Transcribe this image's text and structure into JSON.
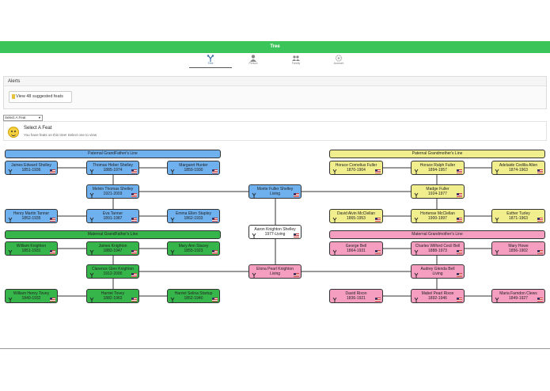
{
  "app": {
    "title": "Tree"
  },
  "nav": [
    {
      "label": "Tree",
      "icon": "tree-icon"
    },
    {
      "label": "Person",
      "icon": "person-icon"
    },
    {
      "label": "Family",
      "icon": "family-icon"
    },
    {
      "label": "Account",
      "icon": "gear-icon"
    }
  ],
  "alerts": {
    "title": "Alerts",
    "feats_label": "View 48 suggested feats"
  },
  "select_feat": {
    "value": "Select A Feat"
  },
  "feat_panel": {
    "title": "Select A Feat",
    "subtitle": "You have feats on this tree! Select one to view"
  },
  "lines": {
    "paternal_grandfather": "Paternal GrandFather's Line",
    "paternal_grandmother": "Paternal Grandmother's Line",
    "maternal_grandfather": "Maternal GrandFather's Line",
    "maternal_grandmother": "Maternal Grandmother's Line"
  },
  "people": {
    "pgf_1": {
      "name": "James Edward Shelley",
      "dates": "1851-1936"
    },
    "pgf_2": {
      "name": "Thomas Heber Shelley",
      "dates": "1885-1974"
    },
    "pgf_3": {
      "name": "Margaret Hunter",
      "dates": "1859-1930"
    },
    "pgf_4": {
      "name": "Melvin Thomas Shelley",
      "dates": "1921-2003"
    },
    "pgf_5": {
      "name": "Henry Martin Tanner",
      "dates": "1852-1935"
    },
    "pgf_6": {
      "name": "Eva Tanner",
      "dates": "1891-1987"
    },
    "pgf_7": {
      "name": "Emma Ellen Stapley",
      "dates": "1862-1933"
    },
    "father": {
      "name": "Monte Fuller Shelley",
      "dates": "Living"
    },
    "self": {
      "name": "Aaron Knighton Shelley",
      "dates": "1977-Living"
    },
    "mother": {
      "name": "Elona Pearl Knighton",
      "dates": "Living"
    },
    "pgm_1": {
      "name": "Horace Cornelius Fuller",
      "dates": "1870-1904"
    },
    "pgm_2": {
      "name": "Horace Ralph Fuller",
      "dates": "1894-1957"
    },
    "pgm_3": {
      "name": "Adelaide Cedilia Allen",
      "dates": "1874-1963"
    },
    "pgm_4": {
      "name": "Madge Fuller",
      "dates": "1924-1977"
    },
    "pgm_5": {
      "name": "David Alvin McClellan",
      "dates": "1865-1953"
    },
    "pgm_6": {
      "name": "Hortense McClellan",
      "dates": "1900-1997"
    },
    "pgm_7": {
      "name": "Esther Turley",
      "dates": "1871-1963"
    },
    "mgf_1": {
      "name": "William Knighton",
      "dates": "1851-1931"
    },
    "mgf_2": {
      "name": "James Knighton",
      "dates": "1882-1947"
    },
    "mgf_3": {
      "name": "Mary Ann Stacey",
      "dates": "1855-1923"
    },
    "mgf_4": {
      "name": "Clarence Glen Knighton",
      "dates": "1912-2000"
    },
    "mgf_5": {
      "name": "William Henry Tovey",
      "dates": "1840-1932"
    },
    "mgf_6": {
      "name": "Harriet Tovey",
      "dates": "1882-1963"
    },
    "mgf_7": {
      "name": "Harriet Selina Startup",
      "dates": "1852-1940"
    },
    "mgm_1": {
      "name": "George Bell",
      "dates": "1864-1931"
    },
    "mgm_2": {
      "name": "Charles Wilford Cecil Bell",
      "dates": "1888-1973"
    },
    "mgm_3": {
      "name": "Mary Howe",
      "dates": "1856-1902"
    },
    "mgm_4": {
      "name": "Audrey Glenda Bell",
      "dates": "Living"
    },
    "mgm_5": {
      "name": "David Rixon",
      "dates": "1836-1921"
    },
    "mgm_6": {
      "name": "Mabel Pearl Rixon",
      "dates": "1892-1946"
    },
    "mgm_7": {
      "name": "Maria Farndon Clews",
      "dates": "1849-1927"
    }
  },
  "colors": {
    "topbar": "#3bc45a",
    "paternal_gf": "#6fb0ee",
    "maternal_gf": "#35b54a",
    "paternal_gm": "#f1ee8e",
    "maternal_gm": "#f59ec0"
  }
}
